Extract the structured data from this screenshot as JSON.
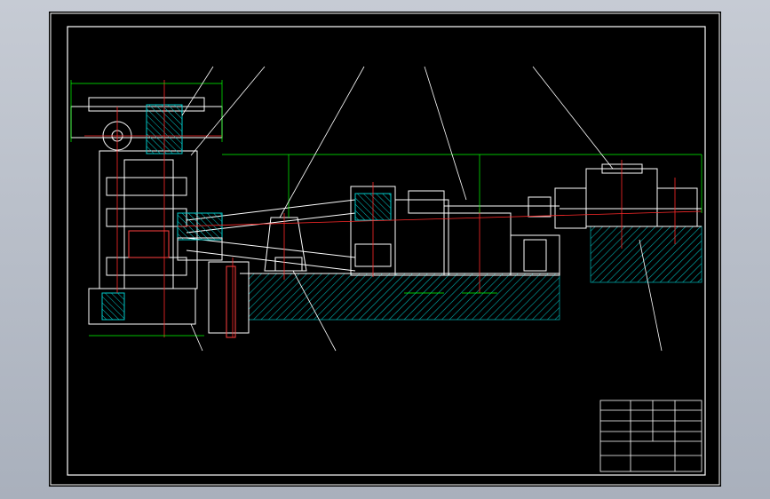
{
  "drawing": {
    "title": "",
    "balloons": [],
    "note_title": "",
    "note_lines": [],
    "title_block_name": "",
    "title_block_code": ""
  },
  "colors": {
    "background": "#000000",
    "frame": "#ffffff",
    "center_line": "#ff0000",
    "section_fill": "#00b4b4",
    "dimension": "#00ff00",
    "machine": "#ffffff",
    "hidden": "#ff4040",
    "annotation": "#ffff00"
  }
}
